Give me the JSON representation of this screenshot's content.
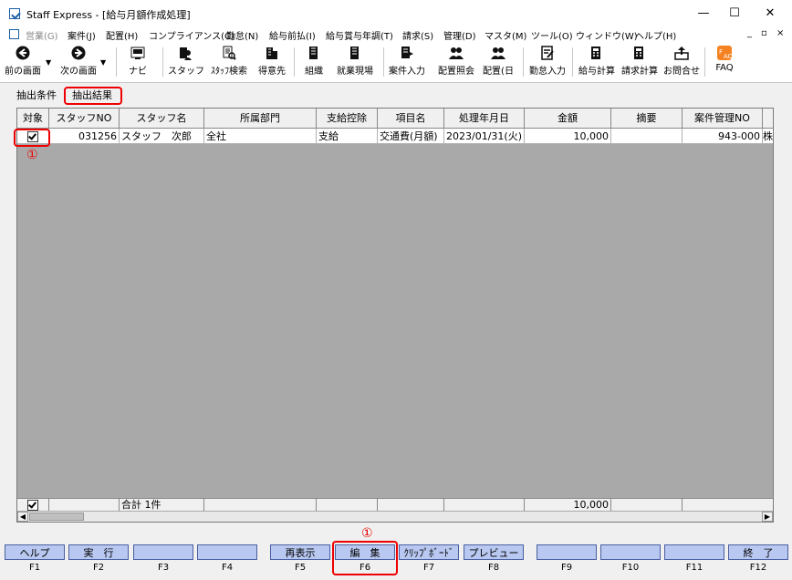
{
  "window": {
    "title": "Staff Express - [給与月額作成処理]",
    "minimize": "—",
    "maximize": "☐",
    "close": "✕",
    "mdi_controls": [
      "_",
      "▫",
      "×"
    ]
  },
  "menu": [
    "営業(G)",
    "案件(J)",
    "配置(H)",
    "コンプライアンス(C)",
    "勤怠(N)",
    "給与前払(I)",
    "給与賞与年調(T)",
    "請求(S)",
    "管理(D)",
    "マスタ(M)",
    "ツール(O)",
    "ウィンドウ(W)",
    "ヘルプ(H)"
  ],
  "toolbar": {
    "back": "前の画面",
    "forward": "次の画面",
    "navi": "ナビ",
    "staff": "スタッフ",
    "staff_search": "ｽﾀｯﾌ検索",
    "client": "得意先",
    "org": "組織",
    "workplace": "就業現場",
    "case_input": "案件入力",
    "placement_inquiry": "配置照会",
    "placement_day": "配置(日",
    "attendance": "勤怠入力",
    "payroll_calc": "給与計算",
    "billing_calc": "請求計算",
    "contact": "お問合せ",
    "faq": "FAQ"
  },
  "tabs": {
    "conditions": "抽出条件",
    "results": "抽出結果"
  },
  "grid": {
    "headers": [
      "対象",
      "スタッフNO",
      "スタッフ名",
      "所属部門",
      "支給控除",
      "項目名",
      "処理年月日",
      "金額",
      "摘要",
      "案件管理NO"
    ],
    "row": {
      "staff_no": "031256",
      "staff_name": "スタッフ　次郎",
      "department": "全社",
      "type": "支給",
      "item": "交通費(月額)",
      "date": "2023/01/31(火)",
      "amount": "10,000",
      "memo": "",
      "case_no": "943-000",
      "extra": "株式"
    },
    "total_label": "合計 1件",
    "total_amount": "10,000"
  },
  "annotations": {
    "marker": "①"
  },
  "fkeys": [
    {
      "label": "ヘルプ",
      "key": "F1"
    },
    {
      "label": "実　行",
      "key": "F2"
    },
    {
      "label": "",
      "key": "F3"
    },
    {
      "label": "",
      "key": "F4"
    },
    {
      "label": "再表示",
      "key": "F5"
    },
    {
      "label": "編　集",
      "key": "F6"
    },
    {
      "label": "ｸﾘｯﾌﾟﾎﾞｰﾄﾞ",
      "key": "F7"
    },
    {
      "label": "プレビュー",
      "key": "F8"
    },
    {
      "label": "",
      "key": "F9"
    },
    {
      "label": "",
      "key": "F10"
    },
    {
      "label": "",
      "key": "F11"
    },
    {
      "label": "終　了",
      "key": "F12"
    }
  ]
}
